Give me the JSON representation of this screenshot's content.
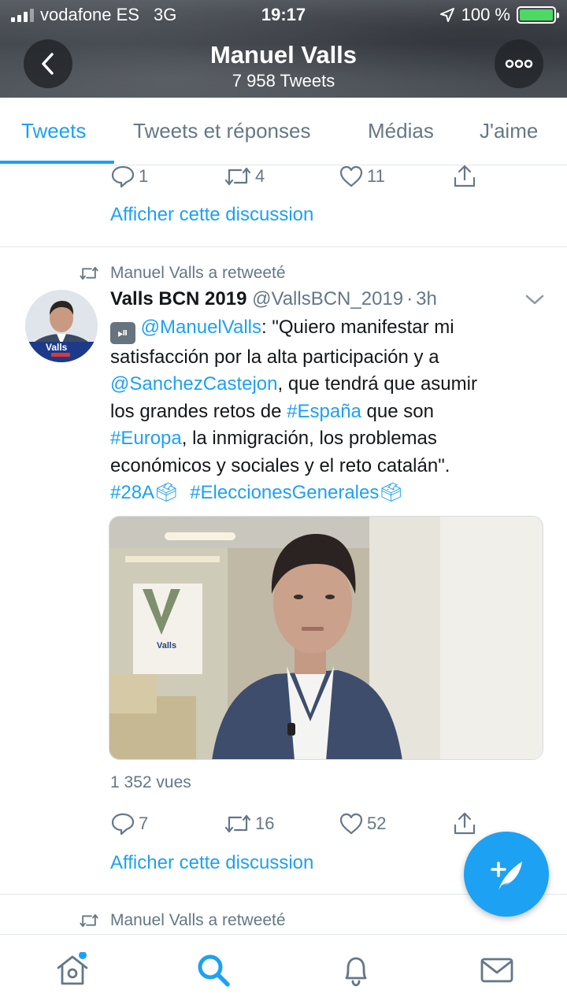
{
  "status_bar": {
    "carrier": "vodafone ES",
    "network": "3G",
    "time": "19:17",
    "battery": "100 %"
  },
  "header": {
    "name": "Manuel Valls",
    "tweet_count": "7 958 Tweets",
    "back_icon": "chevron-left-icon",
    "more_icon": "more-horizontal-icon"
  },
  "tabs": [
    {
      "label": "Tweets",
      "active": true
    },
    {
      "label": "Tweets et réponses",
      "active": false
    },
    {
      "label": "Médias",
      "active": false
    },
    {
      "label": "J'aime",
      "active": false
    }
  ],
  "previous_tweet": {
    "replies": "1",
    "retweets": "4",
    "likes": "11",
    "show_thread": "Afficher cette discussion"
  },
  "tweet": {
    "retweeted_by": "Manuel Valls a retweeté",
    "display_name": "Valls BCN 2019",
    "handle": "@VallsBCN_2019",
    "separator": "·",
    "time": "3h",
    "avatar_badge": "Valls",
    "text_lines": {
      "l1_prefix": "⏯",
      "l1_mention": "@ManuelValls",
      "l1_text": ": \"Quiero manifestar mi",
      "l2": "satisfacción por la alta participación y a",
      "l3_mention": "@SanchezCastejon",
      "l3_text": ", que tendrá que asumir",
      "l4_text": "los grandes retos de ",
      "l4_hashtag": "#España",
      "l4_end": " que son",
      "l5_hashtag": "#Europa",
      "l5_text": ", la inmigración, los problemas",
      "l6": "económicos y sociales y el reto catalán\".",
      "l7_hashtag1": "#28A🗳",
      "l7_hashtag2": "#EleccionesGenerales🗳"
    },
    "media_logo_text": "Valls",
    "views": "1 352 vues",
    "replies": "7",
    "retweets": "16",
    "likes": "52",
    "show_thread": "Afficher cette discussion"
  },
  "next_tweet": {
    "retweeted_by": "Manuel Valls a retweeté"
  },
  "colors": {
    "accent": "#1da1f2",
    "secondary_text": "#657786",
    "divider": "#e1e8ed"
  },
  "bottom_nav": {
    "items": [
      "home-icon",
      "search-icon",
      "notifications-bell-icon",
      "messages-envelope-icon"
    ],
    "active": "search-icon",
    "home_has_dot": true
  },
  "fab": {
    "icon": "compose-tweet-icon"
  }
}
